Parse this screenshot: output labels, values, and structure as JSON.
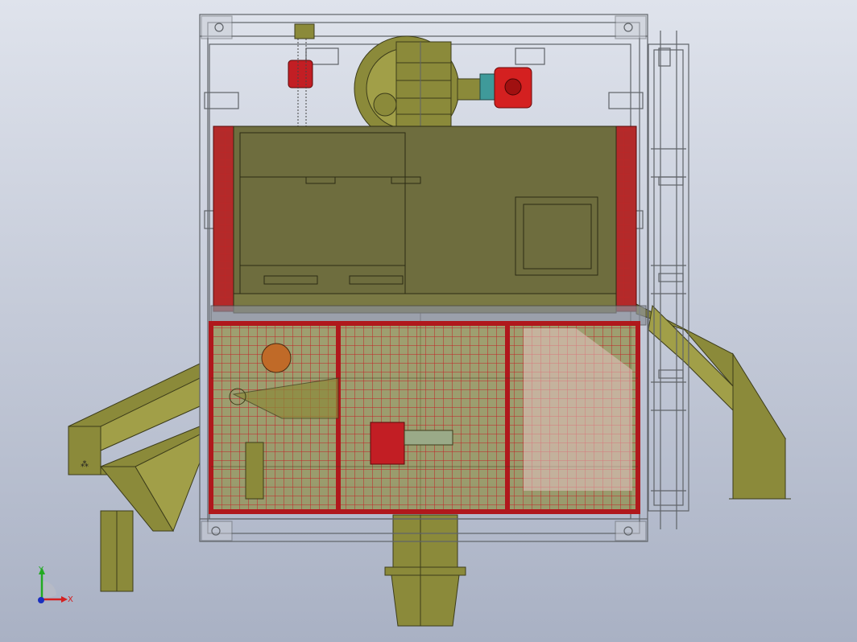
{
  "app": {
    "background_top": "#dfe3ec",
    "background_bottom": "#a9b1c4"
  },
  "colors": {
    "frame": "#5f6368",
    "olive": "#8b8a3a",
    "olive_dark": "#5f5e25",
    "olive_body": "#6e6d3e",
    "guard_red": "#b0181c",
    "mesh_red": "#c32025",
    "motor_red": "#d42020",
    "teal": "#3f9a9a"
  },
  "triad": {
    "x_label": "X",
    "y_label": "Y",
    "icon": "coordinate-triad-icon",
    "x_color": "#d42020",
    "y_color": "#22aa22",
    "z_color": "#1a2fbf"
  },
  "assembly": {
    "description_icons": [
      "chain-hoist-icon",
      "fan-wheel-icon",
      "gear-motor-icon",
      "bucket-elevator-icon",
      "access-ladder-icon",
      "safety-mesh-guard-icon",
      "discharge-chute-icon",
      "hopper-icon"
    ]
  }
}
